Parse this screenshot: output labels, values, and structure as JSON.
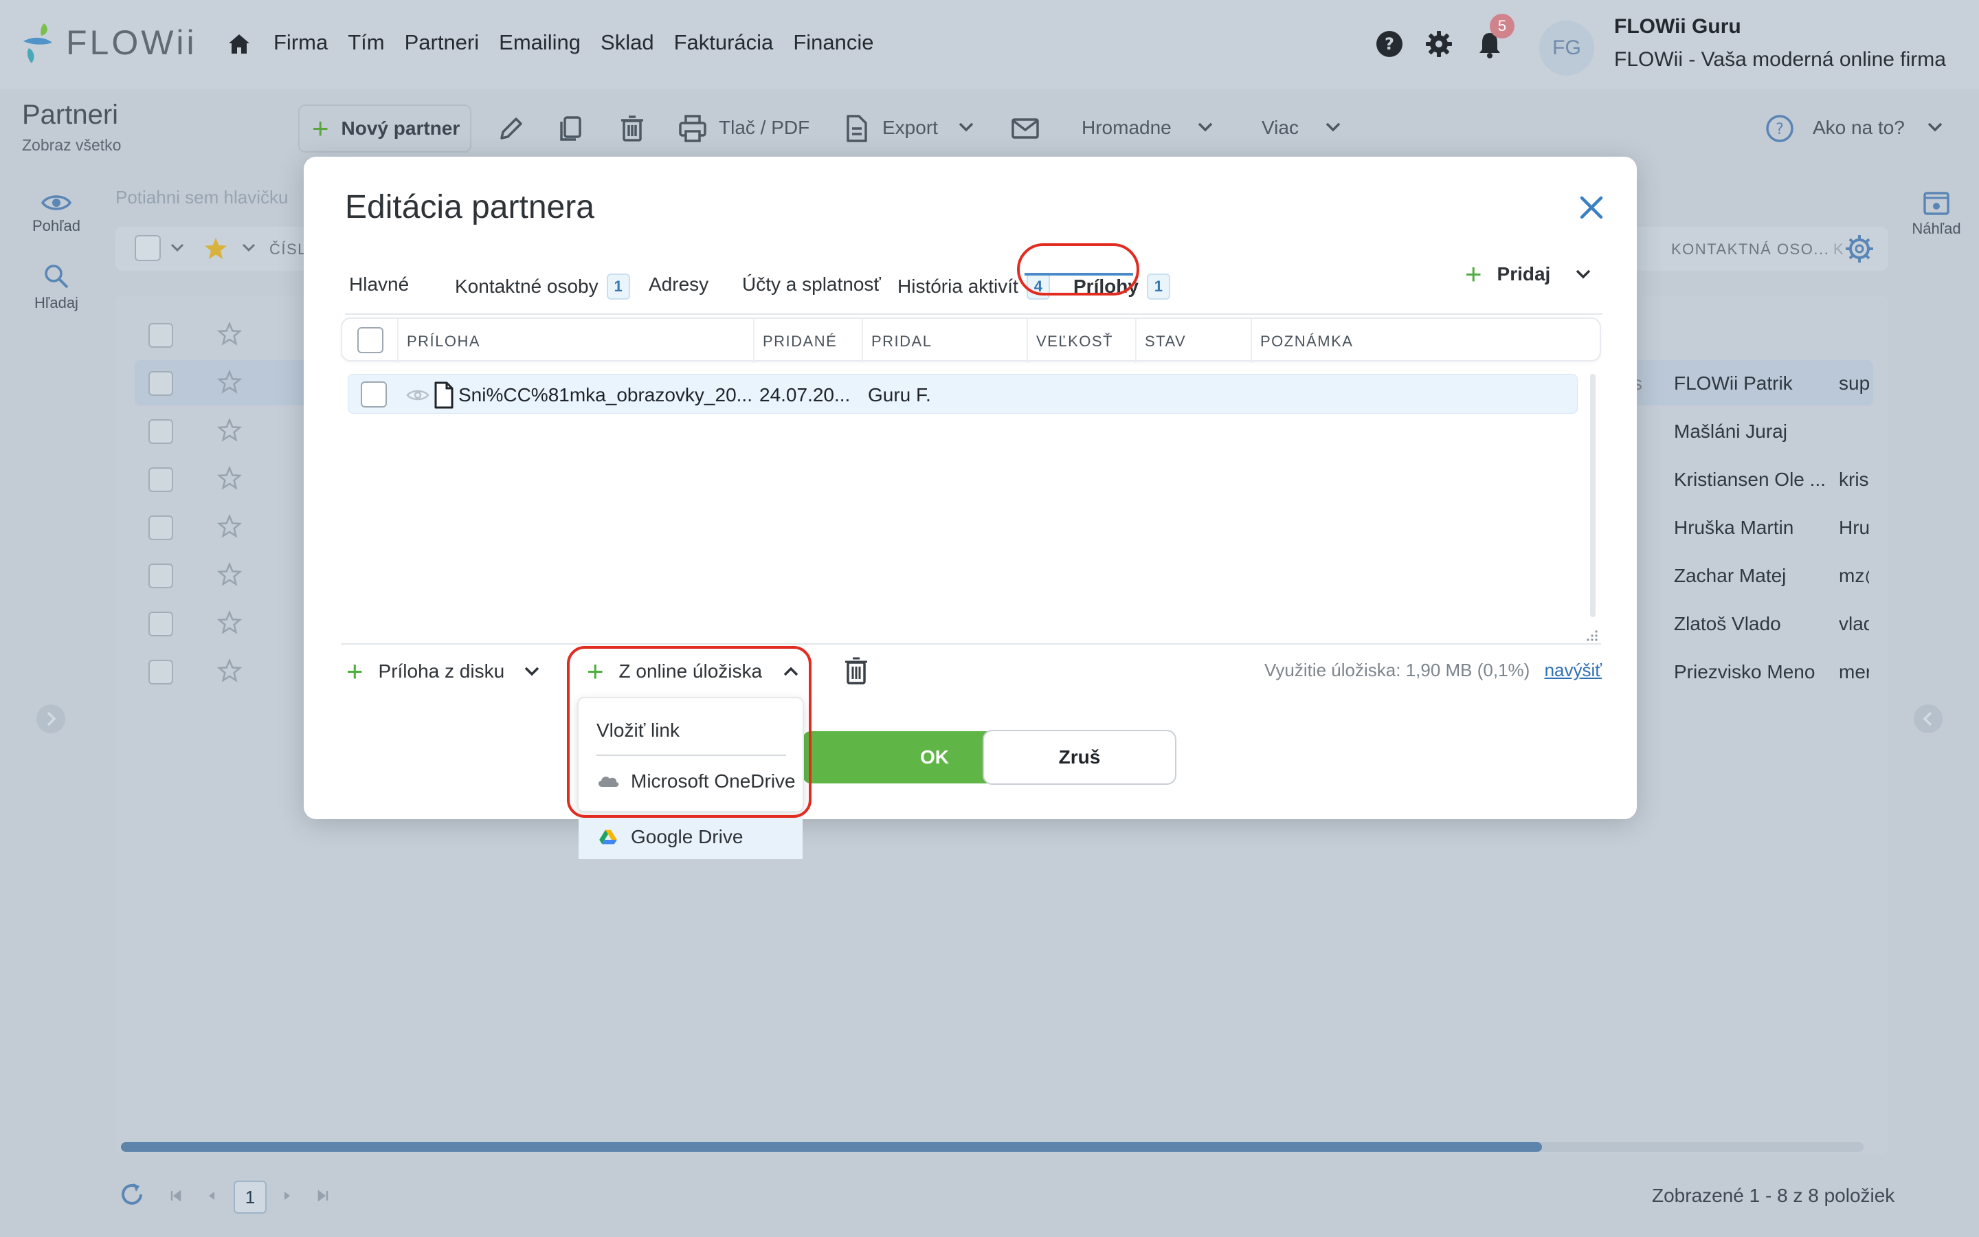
{
  "app": {
    "brand": "FLOWii",
    "nav": [
      "Firma",
      "Tím",
      "Partneri",
      "Emailing",
      "Sklad",
      "Fakturácia",
      "Financie"
    ],
    "notifications_count": "5",
    "avatar_initials": "FG",
    "user_name": "FLOWii Guru",
    "user_company": "FLOWii - Vaša moderná online firma"
  },
  "page": {
    "title": "Partneri",
    "subtitle": "Zobraz všetko",
    "toolbar": {
      "new_partner": "Nový partner",
      "print": "Tlač / PDF",
      "export": "Export",
      "bulk": "Hromadne",
      "more": "Viac",
      "help": "Ako na to?"
    },
    "rail": {
      "view": "Pohľad",
      "search": "Hľadaj",
      "preview": "Náhľad"
    },
    "drag_hint": "Potiahni sem hlavičku",
    "filter_col_number": "ČÍSL",
    "filter_col_contact": "KONTAKTNÁ OSO...",
    "filter_col_k": "K",
    "rows": [
      {
        "name": "",
        "mail": ""
      },
      {
        "name": "FLOWii Patrik",
        "mail": "sup",
        "side": "s"
      },
      {
        "name": "Mašláni Juraj",
        "mail": ""
      },
      {
        "name": "Kristiansen Ole ...",
        "mail": "kris"
      },
      {
        "name": "Hruška Martin",
        "mail": "Hru"
      },
      {
        "name": "Zachar Matej",
        "mail": "mz@"
      },
      {
        "name": "Zlatoš Vlado",
        "mail": "vlad"
      },
      {
        "name": "Priezvisko Meno",
        "mail": "mer"
      }
    ],
    "pager_current": "1",
    "summary": "Zobrazené 1 - 8 z 8 položiek"
  },
  "modal": {
    "title": "Editácia partnera",
    "tabs": [
      {
        "label": "Hlavné"
      },
      {
        "label": "Kontaktné osoby",
        "count": "1"
      },
      {
        "label": "Adresy"
      },
      {
        "label": "Účty a splatnosť"
      },
      {
        "label": "História aktivít",
        "count": "4"
      },
      {
        "label": "Prílohy",
        "count": "1"
      }
    ],
    "add_label": "Pridaj",
    "columns": [
      "PRÍLOHA",
      "PRIDANÉ",
      "PRIDAL",
      "VEĽKOSŤ",
      "STAV",
      "POZNÁMKA"
    ],
    "attachment": {
      "file": "Sni%CC%81mka_obrazovky_20...",
      "date": "24.07.20...",
      "by": "Guru F."
    },
    "from_disk": "Príloha z disku",
    "from_online": "Z online úložiska",
    "usage_label": "Využitie úložiska:",
    "usage_value": "1,90 MB (0,1%)",
    "usage_link": "navýšiť",
    "ok": "OK",
    "cancel": "Zruš",
    "dropdown": [
      "Vložiť link",
      "Microsoft OneDrive",
      "Google Drive"
    ]
  },
  "colors": {
    "accent_green": "#5fb646",
    "highlight_red": "#e22c20",
    "link_blue": "#2f6fb6",
    "tab_underline": "#4b8ac9"
  }
}
